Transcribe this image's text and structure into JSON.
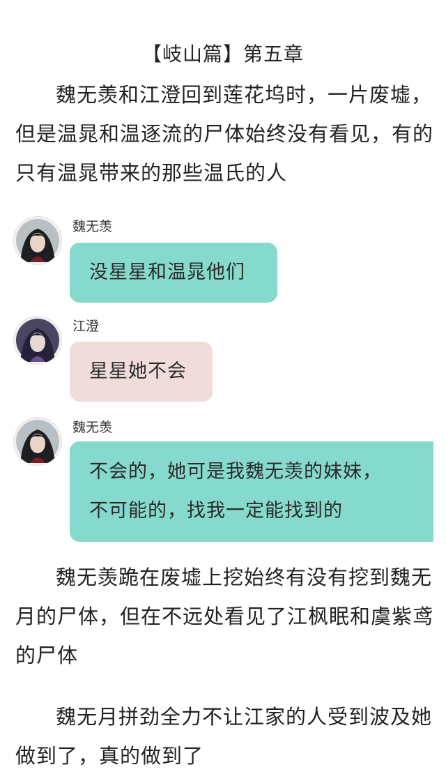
{
  "chapter_title": "【岐山篇】第五章",
  "paragraphs": [
    "魏无羡和江澄回到莲花坞时，一片废墟，但是温晁和温逐流的尸体始终没有看见，有的只有温晁带来的那些温氏的人",
    "魏无羡跪在废墟上挖始终有没有挖到魏无月的尸体，但在不远处看见了江枫眠和虞紫鸢的尸体",
    "魏无月拼劲全力不让江家的人受到波及她做到了，真的做到了"
  ],
  "chat": [
    {
      "speaker": "魏无羡",
      "avatar_icon": "avatar-weiwuxian-icon",
      "lines": [
        "没星星和温晁他们"
      ],
      "bubble_color": "#86d9cd"
    },
    {
      "speaker": "江澄",
      "avatar_icon": "avatar-jiangcheng-icon",
      "lines": [
        "星星她不会"
      ],
      "bubble_color": "#f1dcdc"
    },
    {
      "speaker": "魏无羡",
      "avatar_icon": "avatar-weiwuxian-icon",
      "lines": [
        "不会的，她可是我魏无羡的妹妹，",
        "不可能的，找我一定能找到的"
      ],
      "bubble_color": "#86d9cd"
    }
  ]
}
